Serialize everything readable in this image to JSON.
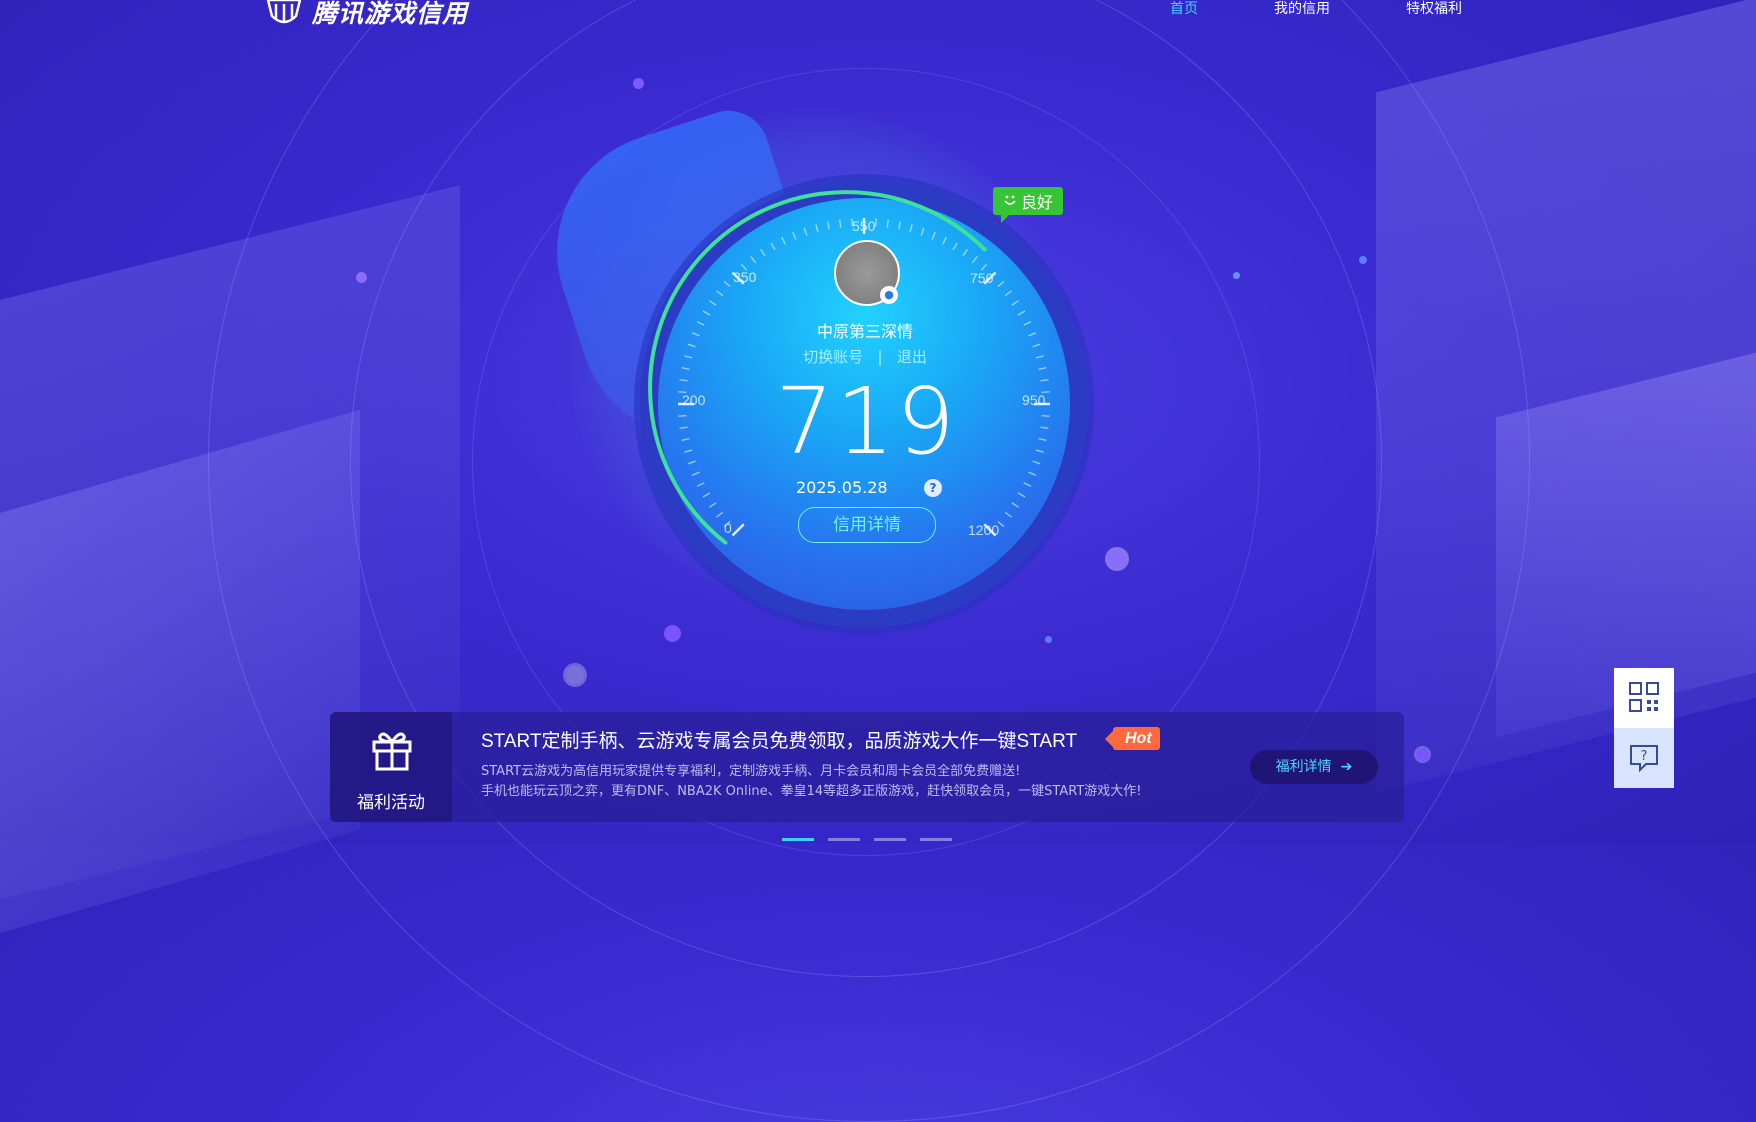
{
  "header": {
    "logo_text": "腾讯游戏信用",
    "nav": [
      {
        "label": "首页",
        "active": true
      },
      {
        "label": "我的信用",
        "active": false
      },
      {
        "label": "特权福利",
        "active": false
      }
    ]
  },
  "gauge": {
    "ticks": [
      "0",
      "200",
      "350",
      "550",
      "750",
      "950",
      "1200"
    ],
    "status": "良好",
    "username": "中原第三深情",
    "switch_account": "切换账号",
    "separator": "|",
    "logout": "退出",
    "score": "719",
    "date": "2025.05.28",
    "help": "?",
    "detail_button": "信用详情"
  },
  "benefit": {
    "left_label": "福利活动",
    "title": "START定制手柄、云游戏专属会员免费领取，品质游戏大作一键START",
    "hot": "Hot",
    "desc1": "START云游戏为高信用玩家提供专享福利，定制游戏手柄、月卡会员和周卡会员全部免费赠送!",
    "desc2": "手机也能玩云顶之弈，更有DNF、NBA2K Online、拳皇14等超多正版游戏，赶快领取会员，一键START游戏大作!",
    "button": "福利详情"
  },
  "colors": {
    "accent": "#35d5ff",
    "status_green": "#35c535",
    "hot_orange": "#ff6a3d"
  },
  "pager": {
    "total": 4,
    "active": 0
  }
}
